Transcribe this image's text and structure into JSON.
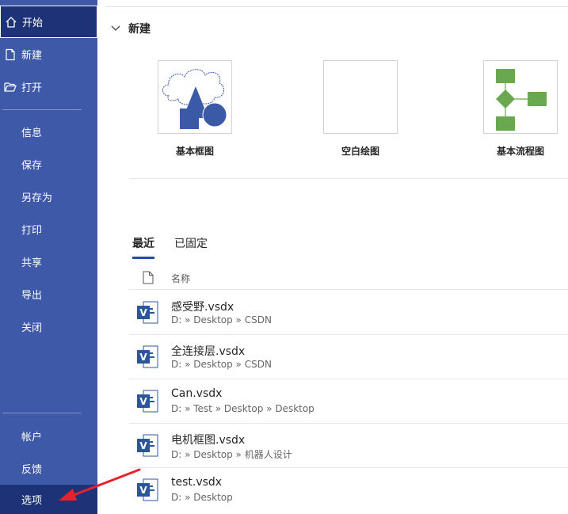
{
  "sidebar": {
    "home_label": "开始",
    "new_label": "新建",
    "open_label": "打开",
    "info_label": "信息",
    "save_label": "保存",
    "saveas_label": "另存为",
    "print_label": "打印",
    "share_label": "共享",
    "export_label": "导出",
    "close_label": "关闭",
    "account_label": "帐户",
    "feedback_label": "反馈",
    "options_label": "选项"
  },
  "new_section": {
    "title": "新建",
    "templates": [
      {
        "label": "基本框图"
      },
      {
        "label": "空白绘图"
      },
      {
        "label": "基本流程图"
      }
    ]
  },
  "tabs": {
    "recent": "最近",
    "pinned": "已固定"
  },
  "list": {
    "name_header": "名称",
    "files": [
      {
        "name": "感受野.vsdx",
        "path": "D: » Desktop » CSDN"
      },
      {
        "name": "全连接层.vsdx",
        "path": "D: » Desktop » CSDN"
      },
      {
        "name": "Can.vsdx",
        "path": "D: » Test » Desktop » Desktop"
      },
      {
        "name": "电机框图.vsdx",
        "path": "D: » Desktop » 机器人设计"
      },
      {
        "name": "test.vsdx",
        "path": "D: » Desktop"
      }
    ]
  },
  "colors": {
    "sidebar_bg": "#3e59a8",
    "sidebar_active": "#1e3277",
    "annotation_arrow": "#e8212a",
    "flowchart_green": "#6aa84f",
    "diagram_blue": "#3a5aa8"
  }
}
